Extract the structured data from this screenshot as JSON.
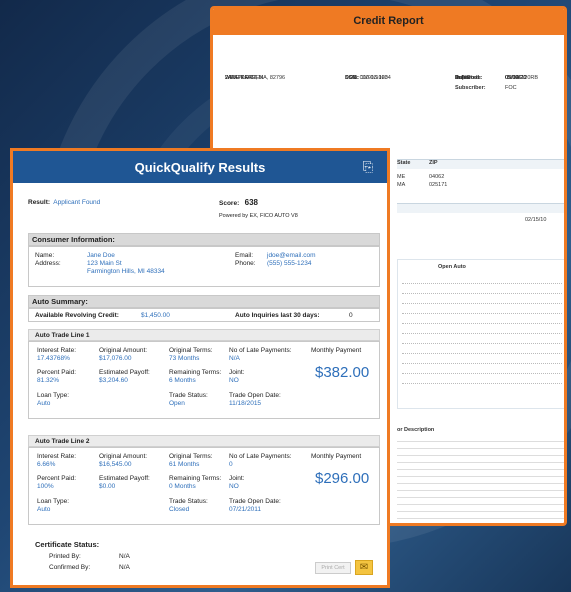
{
  "credit_report": {
    "title": "Credit Report",
    "name": "JANE KAREEN",
    "addr1": "2 MAPLE CT",
    "addr2": "WESTPORT, MA, 82796",
    "dob_label": "DOB:",
    "dob": "11/01/1960",
    "ssn_label": "SSN:",
    "ssn": "000-03-1234",
    "date_label": "Date:",
    "date": "05/02/20",
    "infile_label": "In File:",
    "infile": "09/08/20",
    "reported_label": "Reported:",
    "reported": "05/14/20",
    "subscriber_label": "Subscriber:",
    "subscriber": "FOC",
    "subcode_label": "Sub Code:",
    "subcode": "C0006120RB",
    "state_label": "State",
    "zip_label": "ZIP",
    "state1": "ME",
    "zip1": "04062",
    "state2": "MA",
    "zip2": "025171",
    "date2": "02/15/10",
    "open_label": "Open Auto",
    "desc_title": "or Description"
  },
  "qq": {
    "title": "QuickQualify Results",
    "result_label": "Result:",
    "result": "Applicant Found",
    "score_label": "Score:",
    "score": "638",
    "powered": "Powered by EX, FICO AUTO V8",
    "consumer_header": "Consumer Information:",
    "name_label": "Name:",
    "name": "Jane Doe",
    "address_label": "Address:",
    "address1": "123 Main St",
    "address2": "Farmington Hills, MI 48334",
    "email_label": "Email:",
    "email": "jdoe@email.com",
    "phone_label": "Phone:",
    "phone": "(555) 555-1234",
    "auto_header": "Auto Summary:",
    "revolving_label": "Available Revolving Credit:",
    "revolving": "$1,450.00",
    "inquiries_label": "Auto Inquiries last 30 days:",
    "inquiries": "0",
    "lines": [
      {
        "title": "Auto Trade Line 1",
        "rate_label": "Interest Rate:",
        "rate": "17.43768%",
        "orig_amt_label": "Original Amount:",
        "orig_amt": "$17,076.00",
        "orig_terms_label": "Original Terms:",
        "orig_terms": "73 Months",
        "late_label": "No of Late Payments:",
        "late": "N/A",
        "monthly_label": "Monthly Payment",
        "monthly": "$382.00",
        "paid_label": "Percent Paid:",
        "paid": "81.32%",
        "payoff_label": "Estimated Payoff:",
        "payoff": "$3,204.60",
        "remaining_label": "Remaining Terms:",
        "remaining": "6 Months",
        "joint_label": "Joint:",
        "joint": "NO",
        "loan_label": "Loan Type:",
        "loan": "Auto",
        "status_label": "Trade Status:",
        "status": "Open",
        "opendate_label": "Trade Open Date:",
        "opendate": "11/18/2015"
      },
      {
        "title": "Auto Trade Line 2",
        "rate_label": "Interest Rate:",
        "rate": "6.66%",
        "orig_amt_label": "Original Amount:",
        "orig_amt": "$16,545.00",
        "orig_terms_label": "Original Terms:",
        "orig_terms": "61 Months",
        "late_label": "No of Late Payments:",
        "late": "0",
        "monthly_label": "Monthly Payment",
        "monthly": "$296.00",
        "paid_label": "Percent Paid:",
        "paid": "100%",
        "payoff_label": "Estimated Payoff:",
        "payoff": "$0.00",
        "remaining_label": "Remaining Terms:",
        "remaining": "0 Months",
        "joint_label": "Joint:",
        "joint": "NO",
        "loan_label": "Loan Type:",
        "loan": "Auto",
        "status_label": "Trade Status:",
        "status": "Closed",
        "opendate_label": "Trade Open Date:",
        "opendate": "07/21/2011"
      }
    ],
    "cert_header": "Certificate Status:",
    "printed_label": "Printed By:",
    "printed": "N/A",
    "confirmed_label": "Confirmed By:",
    "confirmed": "N/A",
    "print_btn": "Print Cert"
  }
}
